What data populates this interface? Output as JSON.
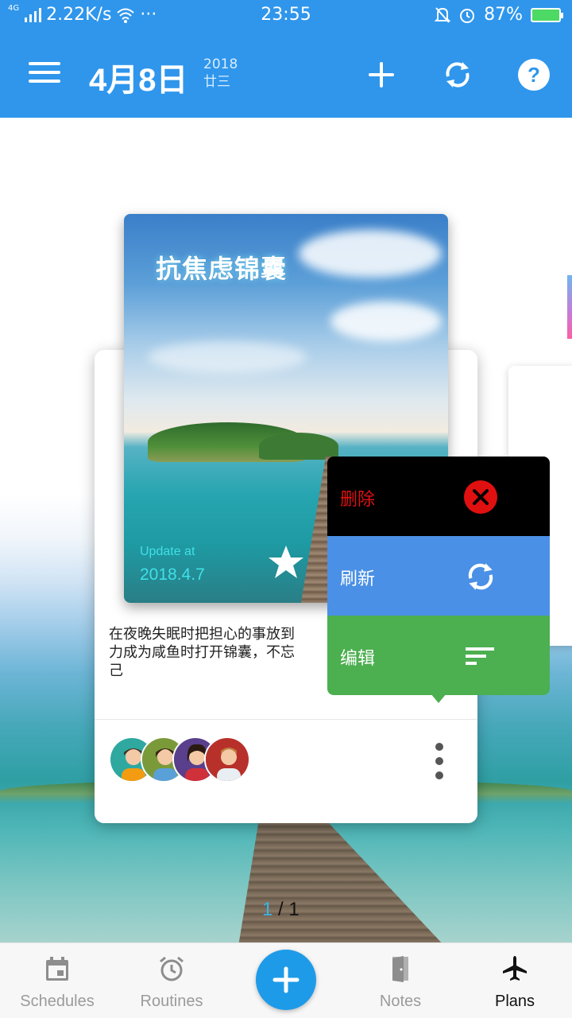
{
  "status_bar": {
    "network": "4G",
    "speed": "2.22K/s",
    "more": "···",
    "time": "23:55",
    "battery": "87%"
  },
  "header": {
    "date": "4月8日",
    "year": "2018",
    "lunar": "廿三",
    "icons": [
      "menu-icon",
      "plus-icon",
      "sync-icon",
      "help-icon"
    ]
  },
  "card": {
    "title": "抗焦虑锦囊",
    "update_label": "Update at",
    "update_date": "2018.4.7",
    "description": "在夜晚失眠时把担心的事放到\n力成为咸鱼时打开锦囊，不忘\n己",
    "avatars": [
      "avatar-woman-green",
      "avatar-woman-olive",
      "avatar-woman-purple",
      "avatar-man-red"
    ]
  },
  "popup_menu": {
    "items": [
      {
        "label": "删除",
        "icon": "close-circle-icon"
      },
      {
        "label": "刷新",
        "icon": "refresh-icon"
      },
      {
        "label": "编辑",
        "icon": "sort-lines-icon"
      }
    ]
  },
  "pager": {
    "current": "1",
    "separator": " / ",
    "total": "1"
  },
  "bottom_nav": {
    "items": [
      {
        "label": "Schedules",
        "icon": "calendar-icon"
      },
      {
        "label": "Routines",
        "icon": "alarm-clock-icon"
      },
      {
        "label": "Notes",
        "icon": "door-icon"
      },
      {
        "label": "Plans",
        "icon": "airplane-icon"
      }
    ],
    "active": "Plans",
    "fab_icon": "plus-icon"
  },
  "colors": {
    "primary": "#2f96ec",
    "delete_bg": "#000000",
    "delete_text": "#e01010",
    "refresh_bg": "#4a90e6",
    "edit_bg": "#4caf50",
    "fab": "#1e9be8",
    "update_text": "#3fe0e8"
  }
}
